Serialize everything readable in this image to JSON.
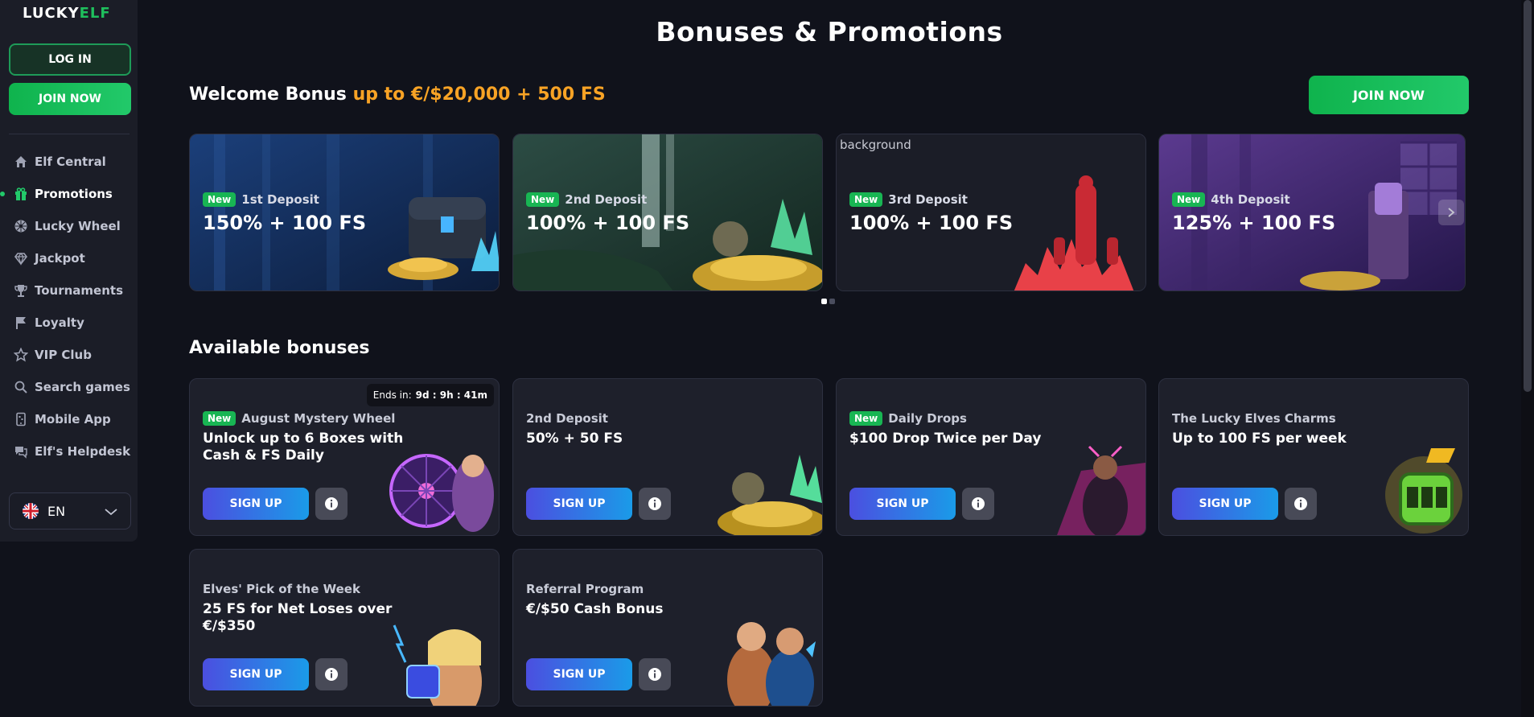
{
  "sidebar": {
    "logo": {
      "part1": "LUCKY",
      "part2": "ELF"
    },
    "login_label": "LOG IN",
    "join_label": "JOIN NOW",
    "items": [
      {
        "label": "Elf Central",
        "icon": "home-icon"
      },
      {
        "label": "Promotions",
        "icon": "gift-icon",
        "active": true
      },
      {
        "label": "Lucky Wheel",
        "icon": "wheel-icon"
      },
      {
        "label": "Jackpot",
        "icon": "diamond-icon"
      },
      {
        "label": "Tournaments",
        "icon": "trophy-icon"
      },
      {
        "label": "Loyalty",
        "icon": "flag-icon"
      },
      {
        "label": "VIP Club",
        "icon": "star-icon"
      },
      {
        "label": "Search games",
        "icon": "search-icon"
      },
      {
        "label": "Mobile App",
        "icon": "mobile-icon"
      },
      {
        "label": "Elf's Helpdesk",
        "icon": "chat-icon"
      }
    ],
    "language": "EN"
  },
  "page": {
    "title": "Bonuses & Promotions",
    "welcome": {
      "prefix": "Welcome Bonus",
      "highlight": "up to €/$20,000 + 500 FS"
    },
    "join_label": "JOIN NOW",
    "carousel_alt_text": "background",
    "available_title": "Available bonuses"
  },
  "deposits": [
    {
      "badge": "New",
      "name": "1st Deposit",
      "offer": "150% + 100 FS"
    },
    {
      "badge": "New",
      "name": "2nd Deposit",
      "offer": "100% + 100 FS"
    },
    {
      "badge": "New",
      "name": "3rd Deposit",
      "offer": "100% + 100 FS"
    },
    {
      "badge": "New",
      "name": "4th Deposit",
      "offer": "125% + 100 FS"
    }
  ],
  "carousel": {
    "page_count": 2,
    "active_page": 1
  },
  "bonuses": [
    {
      "badge": "New",
      "name": "August Mystery Wheel",
      "offer": "Unlock up to 6 Boxes with Cash & FS Daily",
      "ends_label": "Ends in:",
      "ends_value": "9d : 9h : 41m"
    },
    {
      "badge": "",
      "name": "2nd Deposit",
      "offer": "50% + 50 FS"
    },
    {
      "badge": "New",
      "name": "Daily Drops",
      "offer": "$100 Drop Twice per Day"
    },
    {
      "badge": "",
      "name": "The Lucky Elves Charms",
      "offer": "Up to 100 FS per week"
    },
    {
      "badge": "",
      "name": "Elves' Pick of the Week",
      "offer": "25 FS for Net Loses over €/$350"
    },
    {
      "badge": "",
      "name": "Referral Program",
      "offer": "€/$50 Cash Bonus"
    }
  ],
  "signup_label": "SIGN UP",
  "colors": {
    "background": "#10121b",
    "sidebar": "#1b1d27",
    "accent_green": "#22c96a",
    "accent_orange": "#f8a325",
    "signup_from": "#4b4fe0",
    "signup_to": "#1a9be8"
  }
}
